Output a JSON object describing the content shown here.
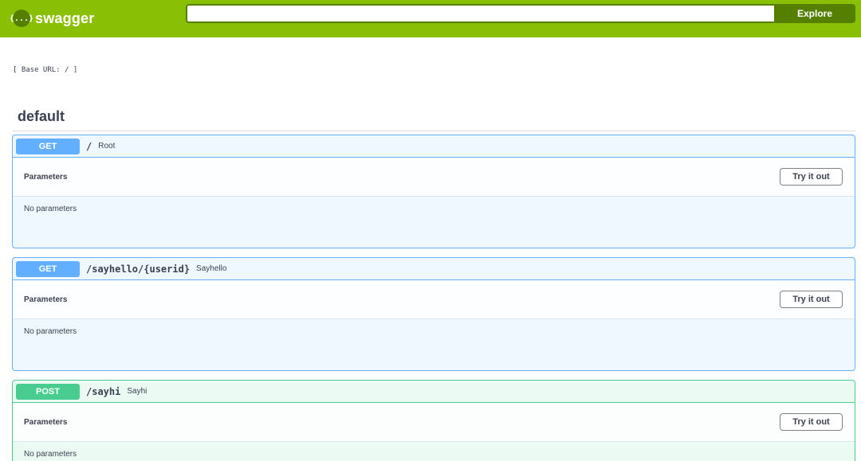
{
  "topbar": {
    "logo_text": "swagger",
    "logo_icon": "{...}",
    "search_value": "",
    "explore_label": "Explore"
  },
  "base_url": "[ Base URL: / ]",
  "section": {
    "title": "default"
  },
  "operations": [
    {
      "method": "GET",
      "path": "/",
      "description": "Root",
      "params_title": "Parameters",
      "try_label": "Try it out",
      "no_params": "No parameters"
    },
    {
      "method": "GET",
      "path": "/sayhello/{userid}",
      "description": "Sayhello",
      "params_title": "Parameters",
      "try_label": "Try it out",
      "no_params": "No parameters"
    },
    {
      "method": "POST",
      "path": "/sayhi",
      "description": "Sayhi",
      "params_title": "Parameters",
      "try_label": "Try it out",
      "no_params": "No parameters"
    }
  ],
  "colors": {
    "topbar": "#89bf04",
    "topbar_dark": "#547f00",
    "get": "#61affe",
    "post": "#49cc90"
  }
}
